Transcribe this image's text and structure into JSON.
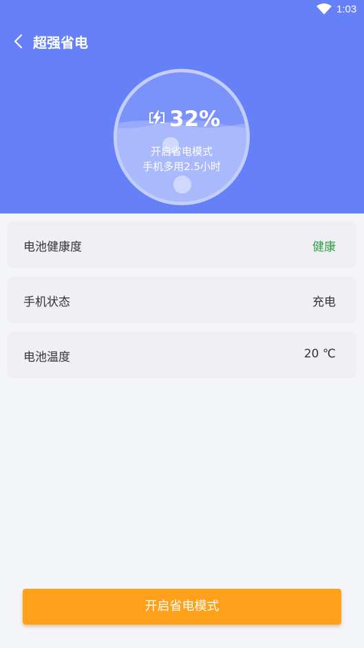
{
  "status_bar": {
    "time": "1:03",
    "wifi_icon": "wifi-icon"
  },
  "app_bar": {
    "back_icon": "chevron-left-icon",
    "title": "超强省电"
  },
  "gauge": {
    "icon": "battery-charging-icon",
    "percent": "32%",
    "battery_level": 0.32,
    "mode_label": "开启省电模式",
    "extra_time_label": "手机多用2.5小时"
  },
  "info_cards": [
    {
      "label": "电池健康度",
      "value": "健康",
      "value_color": "#2e9f46"
    },
    {
      "label": "手机状态",
      "value": "充电"
    },
    {
      "label": "电池温度",
      "value": "20 ℃"
    }
  ],
  "primary_button": {
    "label": "开启省电模式"
  },
  "colors": {
    "header_bg": "#6681f8",
    "page_bg": "#f4f5f9",
    "card_bg": "#f0f0f4",
    "button_bg": "#ffa01a",
    "healthy": "#2e9f46"
  }
}
